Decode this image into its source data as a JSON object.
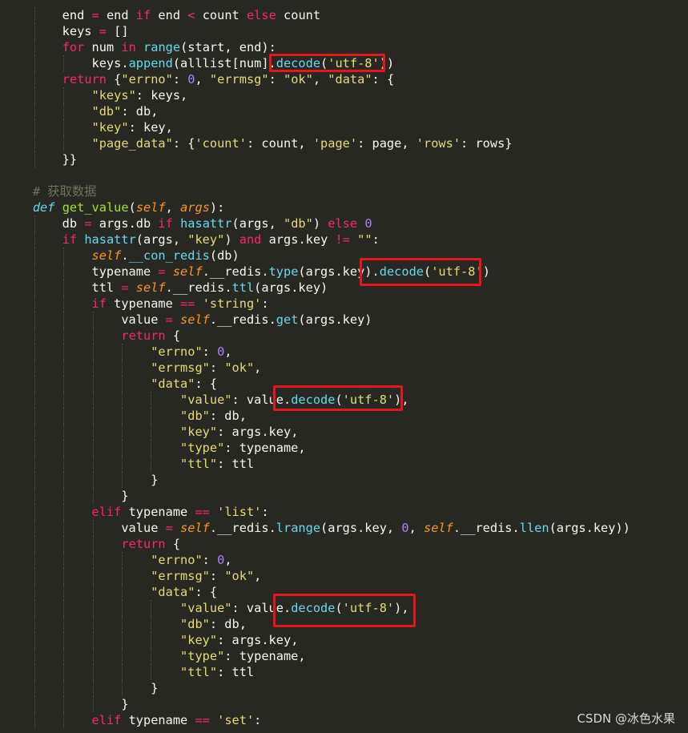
{
  "code": {
    "lines": [
      [
        [
          "pl",
          "        end "
        ],
        [
          "kw",
          "="
        ],
        [
          "pl",
          " end "
        ],
        [
          "kw",
          "if"
        ],
        [
          "pl",
          " end "
        ],
        [
          "kw",
          "<"
        ],
        [
          "pl",
          " count "
        ],
        [
          "kw",
          "else"
        ],
        [
          "pl",
          " count"
        ]
      ],
      [
        [
          "pl",
          "        keys "
        ],
        [
          "kw",
          "="
        ],
        [
          "pl",
          " []"
        ]
      ],
      [
        [
          "pl",
          "        "
        ],
        [
          "kw",
          "for"
        ],
        [
          "pl",
          " num "
        ],
        [
          "kw",
          "in"
        ],
        [
          "pl",
          " "
        ],
        [
          "bi",
          "range"
        ],
        [
          "pl",
          "(start, end):"
        ]
      ],
      [
        [
          "pl",
          "            keys."
        ],
        [
          "bi",
          "append"
        ],
        [
          "pl",
          "(alllist[num]."
        ],
        [
          "bi",
          "decode"
        ],
        [
          "pl",
          "("
        ],
        [
          "str",
          "'utf-8'"
        ],
        [
          "pl",
          "))"
        ]
      ],
      [
        [
          "pl",
          "        "
        ],
        [
          "kw",
          "return"
        ],
        [
          "pl",
          " {"
        ],
        [
          "str",
          "\"errno\""
        ],
        [
          "pl",
          ": "
        ],
        [
          "num",
          "0"
        ],
        [
          "pl",
          ", "
        ],
        [
          "str",
          "\"errmsg\""
        ],
        [
          "pl",
          ": "
        ],
        [
          "str",
          "\"ok\""
        ],
        [
          "pl",
          ", "
        ],
        [
          "str",
          "\"data\""
        ],
        [
          "pl",
          ": {"
        ]
      ],
      [
        [
          "pl",
          "            "
        ],
        [
          "str",
          "\"keys\""
        ],
        [
          "pl",
          ": keys,"
        ]
      ],
      [
        [
          "pl",
          "            "
        ],
        [
          "str",
          "\"db\""
        ],
        [
          "pl",
          ": db,"
        ]
      ],
      [
        [
          "pl",
          "            "
        ],
        [
          "str",
          "\"key\""
        ],
        [
          "pl",
          ": key,"
        ]
      ],
      [
        [
          "pl",
          "            "
        ],
        [
          "str",
          "\"page_data\""
        ],
        [
          "pl",
          ": {"
        ],
        [
          "str",
          "'count'"
        ],
        [
          "pl",
          ": count, "
        ],
        [
          "str",
          "'page'"
        ],
        [
          "pl",
          ": page, "
        ],
        [
          "str",
          "'rows'"
        ],
        [
          "pl",
          ": rows}"
        ]
      ],
      [
        [
          "pl",
          "        }}"
        ]
      ],
      [
        [
          "pl",
          ""
        ]
      ],
      [
        [
          "pl",
          "    "
        ],
        [
          "cmt",
          "# 获取数据"
        ]
      ],
      [
        [
          "pl",
          "    "
        ],
        [
          "def",
          "def"
        ],
        [
          "pl",
          " "
        ],
        [
          "fn",
          "get_value"
        ],
        [
          "pl",
          "("
        ],
        [
          "param",
          "self"
        ],
        [
          "pl",
          ", "
        ],
        [
          "param",
          "args"
        ],
        [
          "pl",
          "):"
        ]
      ],
      [
        [
          "pl",
          "        db "
        ],
        [
          "kw",
          "="
        ],
        [
          "pl",
          " args.db "
        ],
        [
          "kw",
          "if"
        ],
        [
          "pl",
          " "
        ],
        [
          "bi",
          "hasattr"
        ],
        [
          "pl",
          "(args, "
        ],
        [
          "str",
          "\"db\""
        ],
        [
          "pl",
          ") "
        ],
        [
          "kw",
          "else"
        ],
        [
          "pl",
          " "
        ],
        [
          "num",
          "0"
        ]
      ],
      [
        [
          "pl",
          "        "
        ],
        [
          "kw",
          "if"
        ],
        [
          "pl",
          " "
        ],
        [
          "bi",
          "hasattr"
        ],
        [
          "pl",
          "(args, "
        ],
        [
          "str",
          "\"key\""
        ],
        [
          "pl",
          ") "
        ],
        [
          "kw",
          "and"
        ],
        [
          "pl",
          " args.key "
        ],
        [
          "kw",
          "!="
        ],
        [
          "pl",
          " "
        ],
        [
          "str",
          "\"\""
        ],
        [
          "pl",
          ":"
        ]
      ],
      [
        [
          "pl",
          "            "
        ],
        [
          "self",
          "self"
        ],
        [
          "pl",
          "."
        ],
        [
          "bi",
          "__con_redis"
        ],
        [
          "pl",
          "(db)"
        ]
      ],
      [
        [
          "pl",
          "            typename "
        ],
        [
          "kw",
          "="
        ],
        [
          "pl",
          " "
        ],
        [
          "self",
          "self"
        ],
        [
          "pl",
          ".__redis."
        ],
        [
          "bi",
          "type"
        ],
        [
          "pl",
          "(args.key)."
        ],
        [
          "bi",
          "decode"
        ],
        [
          "pl",
          "("
        ],
        [
          "str",
          "'utf-8'"
        ],
        [
          "pl",
          ")"
        ]
      ],
      [
        [
          "pl",
          "            ttl "
        ],
        [
          "kw",
          "="
        ],
        [
          "pl",
          " "
        ],
        [
          "self",
          "self"
        ],
        [
          "pl",
          ".__redis."
        ],
        [
          "bi",
          "ttl"
        ],
        [
          "pl",
          "(args.key)"
        ]
      ],
      [
        [
          "pl",
          "            "
        ],
        [
          "kw",
          "if"
        ],
        [
          "pl",
          " typename "
        ],
        [
          "kw",
          "=="
        ],
        [
          "pl",
          " "
        ],
        [
          "str",
          "'string'"
        ],
        [
          "pl",
          ":"
        ]
      ],
      [
        [
          "pl",
          "                value "
        ],
        [
          "kw",
          "="
        ],
        [
          "pl",
          " "
        ],
        [
          "self",
          "self"
        ],
        [
          "pl",
          ".__redis."
        ],
        [
          "bi",
          "get"
        ],
        [
          "pl",
          "(args.key)"
        ]
      ],
      [
        [
          "pl",
          "                "
        ],
        [
          "kw",
          "return"
        ],
        [
          "pl",
          " {"
        ]
      ],
      [
        [
          "pl",
          "                    "
        ],
        [
          "str",
          "\"errno\""
        ],
        [
          "pl",
          ": "
        ],
        [
          "num",
          "0"
        ],
        [
          "pl",
          ","
        ]
      ],
      [
        [
          "pl",
          "                    "
        ],
        [
          "str",
          "\"errmsg\""
        ],
        [
          "pl",
          ": "
        ],
        [
          "str",
          "\"ok\""
        ],
        [
          "pl",
          ","
        ]
      ],
      [
        [
          "pl",
          "                    "
        ],
        [
          "str",
          "\"data\""
        ],
        [
          "pl",
          ": {"
        ]
      ],
      [
        [
          "pl",
          "                        "
        ],
        [
          "str",
          "\"value\""
        ],
        [
          "pl",
          ": value."
        ],
        [
          "bi",
          "decode"
        ],
        [
          "pl",
          "("
        ],
        [
          "str",
          "'utf-8'"
        ],
        [
          "pl",
          "),"
        ]
      ],
      [
        [
          "pl",
          "                        "
        ],
        [
          "str",
          "\"db\""
        ],
        [
          "pl",
          ": db,"
        ]
      ],
      [
        [
          "pl",
          "                        "
        ],
        [
          "str",
          "\"key\""
        ],
        [
          "pl",
          ": args.key,"
        ]
      ],
      [
        [
          "pl",
          "                        "
        ],
        [
          "str",
          "\"type\""
        ],
        [
          "pl",
          ": typename,"
        ]
      ],
      [
        [
          "pl",
          "                        "
        ],
        [
          "str",
          "\"ttl\""
        ],
        [
          "pl",
          ": ttl"
        ]
      ],
      [
        [
          "pl",
          "                    }"
        ]
      ],
      [
        [
          "pl",
          "                }"
        ]
      ],
      [
        [
          "pl",
          "            "
        ],
        [
          "kw",
          "elif"
        ],
        [
          "pl",
          " typename "
        ],
        [
          "kw",
          "=="
        ],
        [
          "pl",
          " "
        ],
        [
          "str",
          "'list'"
        ],
        [
          "pl",
          ":"
        ]
      ],
      [
        [
          "pl",
          "                value "
        ],
        [
          "kw",
          "="
        ],
        [
          "pl",
          " "
        ],
        [
          "self",
          "self"
        ],
        [
          "pl",
          ".__redis."
        ],
        [
          "bi",
          "lrange"
        ],
        [
          "pl",
          "(args.key, "
        ],
        [
          "num",
          "0"
        ],
        [
          "pl",
          ", "
        ],
        [
          "self",
          "self"
        ],
        [
          "pl",
          ".__redis."
        ],
        [
          "bi",
          "llen"
        ],
        [
          "pl",
          "(args.key))"
        ]
      ],
      [
        [
          "pl",
          "                "
        ],
        [
          "kw",
          "return"
        ],
        [
          "pl",
          " {"
        ]
      ],
      [
        [
          "pl",
          "                    "
        ],
        [
          "str",
          "\"errno\""
        ],
        [
          "pl",
          ": "
        ],
        [
          "num",
          "0"
        ],
        [
          "pl",
          ","
        ]
      ],
      [
        [
          "pl",
          "                    "
        ],
        [
          "str",
          "\"errmsg\""
        ],
        [
          "pl",
          ": "
        ],
        [
          "str",
          "\"ok\""
        ],
        [
          "pl",
          ","
        ]
      ],
      [
        [
          "pl",
          "                    "
        ],
        [
          "str",
          "\"data\""
        ],
        [
          "pl",
          ": {"
        ]
      ],
      [
        [
          "pl",
          "                        "
        ],
        [
          "str",
          "\"value\""
        ],
        [
          "pl",
          ": value."
        ],
        [
          "bi",
          "decode"
        ],
        [
          "pl",
          "("
        ],
        [
          "str",
          "'utf-8'"
        ],
        [
          "pl",
          "),"
        ]
      ],
      [
        [
          "pl",
          "                        "
        ],
        [
          "str",
          "\"db\""
        ],
        [
          "pl",
          ": db,"
        ]
      ],
      [
        [
          "pl",
          "                        "
        ],
        [
          "str",
          "\"key\""
        ],
        [
          "pl",
          ": args.key,"
        ]
      ],
      [
        [
          "pl",
          "                        "
        ],
        [
          "str",
          "\"type\""
        ],
        [
          "pl",
          ": typename,"
        ]
      ],
      [
        [
          "pl",
          "                        "
        ],
        [
          "str",
          "\"ttl\""
        ],
        [
          "pl",
          ": ttl"
        ]
      ],
      [
        [
          "pl",
          "                    }"
        ]
      ],
      [
        [
          "pl",
          "                }"
        ]
      ],
      [
        [
          "pl",
          "            "
        ],
        [
          "kw",
          "elif"
        ],
        [
          "pl",
          " typename "
        ],
        [
          "kw",
          "=="
        ],
        [
          "pl",
          " "
        ],
        [
          "str",
          "'set'"
        ],
        [
          "pl",
          ":"
        ]
      ]
    ],
    "highlighted": ".decode('utf-8')"
  },
  "watermark": "CSDN @冰色水果",
  "colors": {
    "background": "#272822",
    "keyword": "#f92672",
    "function": "#a6e22e",
    "builtin": "#66d9ef",
    "string": "#e6db74",
    "number": "#ae81ff",
    "self": "#fd971f",
    "comment": "#75715e",
    "highlight_box": "#e8141b"
  }
}
